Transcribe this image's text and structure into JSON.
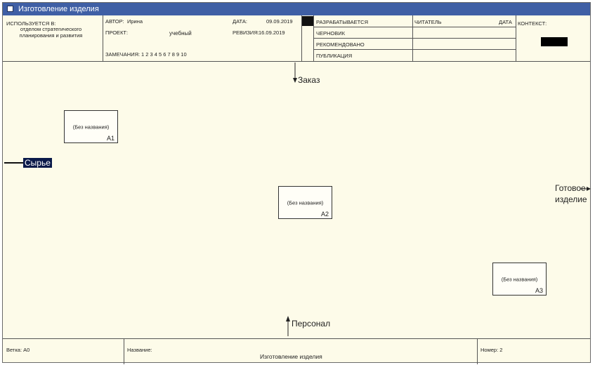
{
  "window": {
    "title": "Изготовление изделия"
  },
  "header": {
    "used_in_label": "ИСПОЛЬЗУЕТСЯ В:",
    "used_in_value": "отделом стратегического планирования и развития",
    "author_label": "АВТОР:",
    "author_value": "Ирина",
    "date_label": "ДАТА:",
    "date_value": "09.09.2019",
    "project_label": "ПРОЕКТ:",
    "project_value": "учебный",
    "revision_label": "РЕВИЗИЯ:",
    "revision_value": "16.09.2019",
    "notes_label": "ЗАМЕЧАНИЯ:",
    "notes_value": "1 2 3 4 5 6 7 8 9 10",
    "statuses": [
      "РАЗРАБАТЫВАЕТСЯ",
      "ЧЕРНОВИК",
      "РЕКОМЕНДОВАНО",
      "ПУБЛИКАЦИЯ"
    ],
    "reader_label": "ЧИТАТЕЛЬ",
    "reader_date_label": "ДАТА",
    "context_label": "КОНТЕКСТ:"
  },
  "diagram": {
    "boxes": [
      {
        "label": "(Без названия)",
        "number": "A1"
      },
      {
        "label": "(Без названия)",
        "number": "A2"
      },
      {
        "label": "(Без названия)",
        "number": "A3"
      }
    ],
    "arrows": {
      "control": "Заказ",
      "input": "Сырье",
      "output_line1": "Готовое",
      "output_line2": "изделие",
      "mechanism": "Персонал"
    }
  },
  "footer": {
    "node_label": "Ветка:",
    "node_value": "A0",
    "name_label": "Название:",
    "name_value": "Изготовление изделия",
    "number_label": "Номер:",
    "number_value": "2"
  }
}
